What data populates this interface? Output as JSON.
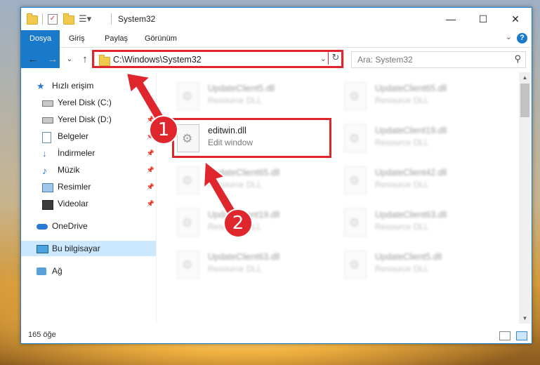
{
  "window": {
    "title": "System32"
  },
  "ribbon": {
    "tabs": [
      "Dosya",
      "Giriş",
      "Paylaş",
      "Görünüm"
    ]
  },
  "address": {
    "path": "C:\\Windows\\System32"
  },
  "search": {
    "placeholder": "Ara: System32"
  },
  "sidebar": {
    "items": [
      {
        "label": "Hızlı erişim",
        "icon": "star-icon"
      },
      {
        "label": "Yerel Disk (C:)",
        "icon": "drive-icon"
      },
      {
        "label": "Yerel Disk (D:)",
        "icon": "drive-icon"
      },
      {
        "label": "Belgeler",
        "icon": "document-icon"
      },
      {
        "label": "İndirmeler",
        "icon": "download-icon"
      },
      {
        "label": "Müzik",
        "icon": "music-icon"
      },
      {
        "label": "Resimler",
        "icon": "pictures-icon"
      },
      {
        "label": "Videolar",
        "icon": "video-icon"
      },
      {
        "label": "OneDrive",
        "icon": "cloud-icon"
      },
      {
        "label": "Bu bilgisayar",
        "icon": "computer-icon"
      },
      {
        "label": "Ağ",
        "icon": "network-icon"
      }
    ]
  },
  "files": [
    {
      "name": "UpdateClient5.dll",
      "desc": "Resource DLL"
    },
    {
      "name": "UpdateClient65.dll",
      "desc": "Resource DLL"
    },
    {
      "name": "editwin.dll",
      "desc": "Edit window"
    },
    {
      "name": "UpdateClient19.dll",
      "desc": "Resource DLL"
    },
    {
      "name": "UpdateClient65.dll",
      "desc": "Resource DLL"
    },
    {
      "name": "UpdateClient42.dll",
      "desc": "Resource DLL"
    },
    {
      "name": "UpdateClient19.dll",
      "desc": "Resource DLL"
    },
    {
      "name": "UpdateClient63.dll",
      "desc": "Resource DLL"
    },
    {
      "name": "UpdateClient63.dll",
      "desc": "Resource DLL"
    },
    {
      "name": "UpdateClient5.dll",
      "desc": "Resource DLL"
    }
  ],
  "status": {
    "count": "165 öğe"
  },
  "annotations": {
    "step1": "1",
    "step2": "2",
    "color": "#e0262d"
  },
  "colors": {
    "accent": "#1979ca",
    "selection": "#cce8ff"
  }
}
